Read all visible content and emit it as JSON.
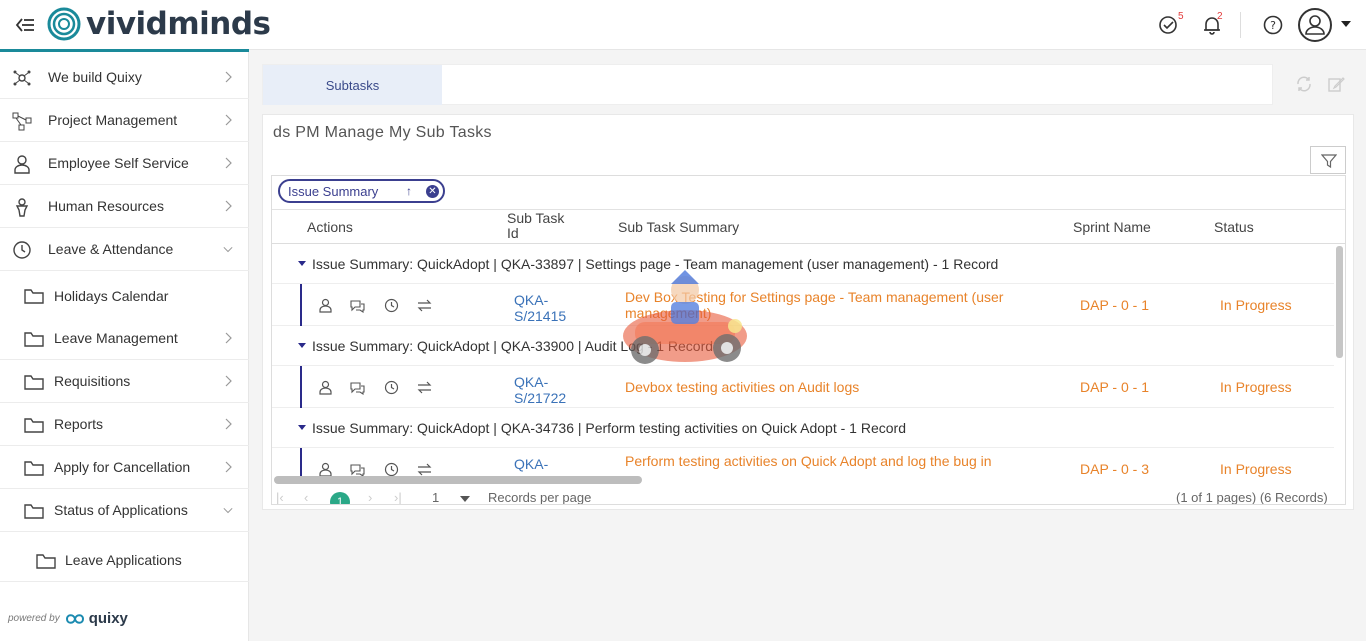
{
  "brand": {
    "name": "vividminds",
    "powered_by": "powered by",
    "quixy": "quixy"
  },
  "header": {
    "tasks_badge": "5",
    "notifications_badge": "2"
  },
  "sidebar": {
    "items": [
      {
        "label": "We build Quixy"
      },
      {
        "label": "Project Management"
      },
      {
        "label": "Employee Self Service"
      },
      {
        "label": "Human Resources"
      },
      {
        "label": "Leave & Attendance"
      },
      {
        "label": "Holidays Calendar"
      },
      {
        "label": "Leave Management"
      },
      {
        "label": "Requisitions"
      },
      {
        "label": "Reports"
      },
      {
        "label": "Apply for Cancellation"
      },
      {
        "label": "Status of Applications"
      },
      {
        "label": "Leave Applications"
      }
    ]
  },
  "tabs": {
    "active": "Subtasks"
  },
  "panel": {
    "title": "ds PM Manage My Sub Tasks",
    "group_chip": "Issue Summary",
    "columns": {
      "actions": "Actions",
      "sub_task_id": "Sub Task Id",
      "summary": "Sub Task Summary",
      "sprint": "Sprint Name",
      "status": "Status"
    },
    "groups": [
      {
        "header": "Issue Summary: QuickAdopt | QKA-33897 | Settings page - Team management (user management) - 1 Record",
        "row": {
          "id": "QKA-S/21415",
          "summary": "Dev Box Testing for Settings page - Team management (user management)",
          "sprint": "DAP - 0 - 1",
          "status": "In Progress"
        }
      },
      {
        "header": "Issue Summary: QuickAdopt | QKA-33900 | Audit Log - 1 Record",
        "row": {
          "id": "QKA-S/21722",
          "summary": "Devbox testing activities on Audit logs",
          "sprint": "DAP - 0 - 1",
          "status": "In Progress"
        }
      },
      {
        "header": "Issue Summary: QuickAdopt | QKA-34736 | Perform testing activities on Quick Adopt - 1 Record",
        "row": {
          "id": "QKA-",
          "summary": "Perform testing activities on Quick Adopt and log the bug in",
          "sprint": "DAP - 0 - 3",
          "status": "In Progress"
        }
      }
    ],
    "pager": {
      "current": "1",
      "page_size": "1",
      "records_per_page": "Records per page",
      "summary": "(1 of 1 pages) (6 Records)"
    }
  },
  "colors": {
    "accent": "#1a8a9a",
    "primary": "#3b3f8f",
    "orange": "#e8832a",
    "link": "#3a72b8",
    "active_page": "#2aa887"
  }
}
